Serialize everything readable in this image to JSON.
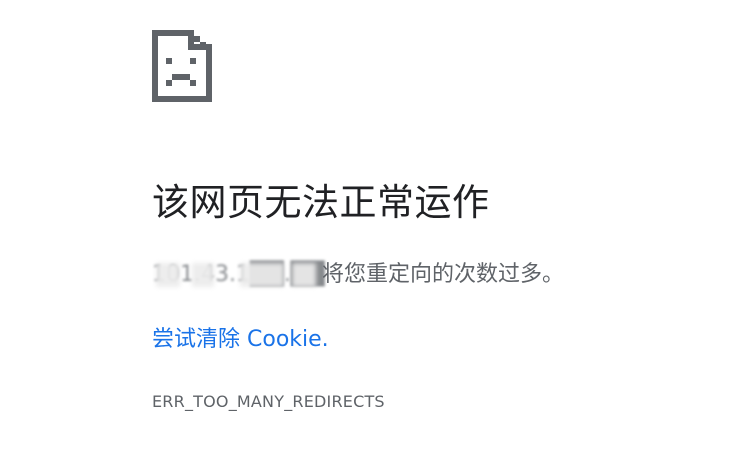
{
  "icon": {
    "name": "sad-page-icon",
    "color": "#5f6368"
  },
  "error": {
    "title": "该网页无法正常运作",
    "host_redacted": "101.43.1██.██",
    "description_suffix": "将您重定向的次数过多。",
    "cookie_link": "尝试清除 Cookie.",
    "code": "ERR_TOO_MANY_REDIRECTS"
  },
  "colors": {
    "title": "#202124",
    "body_text": "#5f6368",
    "link": "#1a73e8",
    "background": "#ffffff"
  }
}
